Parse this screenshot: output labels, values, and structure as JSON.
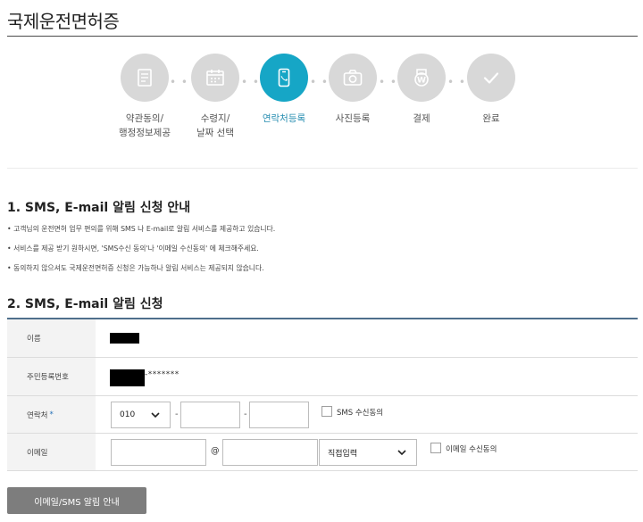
{
  "page": {
    "title": "국제운전면허증"
  },
  "steps": [
    {
      "label": "약관동의/\n행정정보제공",
      "icon": "document-icon",
      "active": false
    },
    {
      "label": "수령지/\n날짜 선택",
      "icon": "calendar-icon",
      "active": false
    },
    {
      "label": "연락처등록",
      "icon": "phone-icon",
      "active": true
    },
    {
      "label": "사진등록",
      "icon": "camera-icon",
      "active": false
    },
    {
      "label": "결제",
      "icon": "payment-icon",
      "active": false
    },
    {
      "label": "완료",
      "icon": "check-icon",
      "active": false
    }
  ],
  "section1": {
    "title": "1. SMS, E-mail 알림 신청 안내",
    "bullets": [
      "• 고객님의 운전면허 업무 편의를 위해 SMS 나 E-mail로 알림 서비스를 제공하고 있습니다.",
      "• 서비스를 제공 받기 원하시면, 'SMS수신 동의'나 '이메일 수신동의' 에 체크해주세요.",
      "• 동의하지 않으셔도 국제운전면허증 신청은 가능하나 알림 서비스는 제공되지 않습니다."
    ]
  },
  "section2": {
    "title": "2. SMS, E-mail 알림 신청"
  },
  "form": {
    "name_label": "이름",
    "rrn_label": "주민등록번호",
    "rrn_mask": "-*******",
    "phone_label": "연락처",
    "required_mark": "*",
    "phone_prefix": "010",
    "phone_middle": "",
    "phone_last": "",
    "dash": "-",
    "sms_consent_label": "SMS 수신동의",
    "sms_consent_checked": false,
    "email_label": "이메일",
    "email_id": "",
    "at": "@",
    "email_domain": "",
    "domain_select": "직접입력",
    "email_consent_label": "이메일 수신동의",
    "email_consent_checked": false
  },
  "buttons": {
    "guide": "이메일/SMS 알림 안내"
  },
  "colors": {
    "active_step": "#16a6c6",
    "inactive_step": "#d8d8d8",
    "table_top_border": "#4f6f8c",
    "button_bg": "#7d7d7d"
  }
}
